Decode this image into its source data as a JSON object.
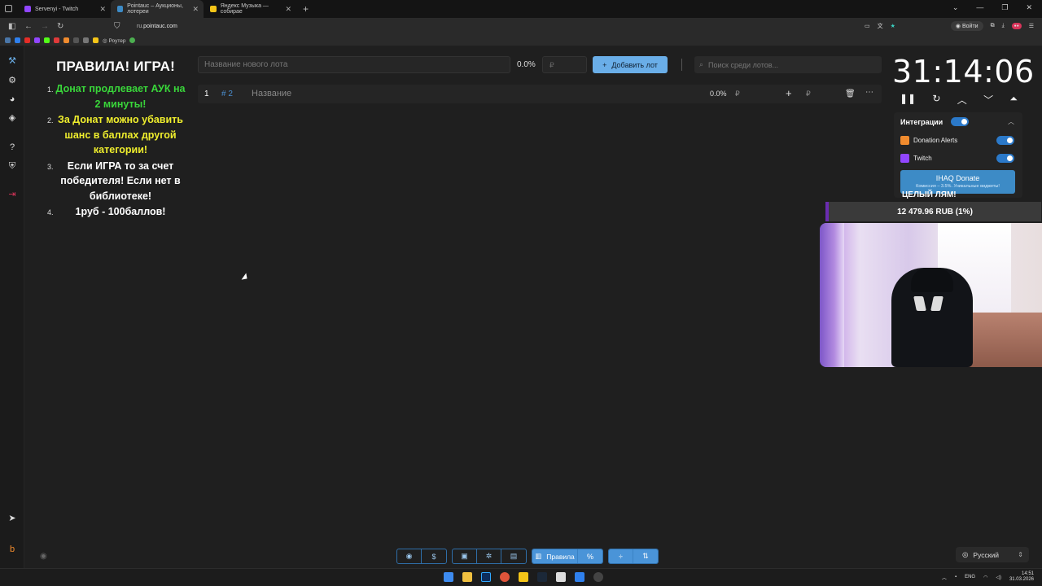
{
  "browser": {
    "tabs": [
      {
        "title": "Servenyi - Twitch",
        "favicon_color": "#9146ff",
        "active": false
      },
      {
        "title": "Pointauc – Аукционы, лотереи",
        "favicon_color": "#3d8bc6",
        "active": true
      },
      {
        "title": "Яндекс Музыка — собирае",
        "favicon_color": "#f5c518",
        "active": false
      }
    ],
    "url_prefix": "ru.",
    "url_domain": "pointauc.com",
    "login_label": "Войти",
    "bookmarks_label": "Роутер"
  },
  "rules": {
    "title": "ПРАВИЛА! ИГРА!",
    "items": [
      {
        "num": "1.",
        "parts": [
          {
            "text": "Донат продлевает АУК на 2 минуты!",
            "color": "green"
          }
        ]
      },
      {
        "num": "2.",
        "parts": [
          {
            "text": "За Донат можно убавить шанс в баллах другой категории!",
            "color": "yellow"
          }
        ]
      },
      {
        "num": "3.",
        "parts": [
          {
            "text": "Если ИГРА то за счет победителя! Если нет в библиотеке!",
            "color": "white"
          }
        ]
      },
      {
        "num": "4.",
        "parts": [
          {
            "text": "1руб - 100баллов!",
            "color": "white"
          }
        ]
      }
    ]
  },
  "lot_form": {
    "name_placeholder": "Название нового лота",
    "percent": "0.0%",
    "amount_placeholder": "₽",
    "add_label": "Добавить лот",
    "search_placeholder": "Поиск среди лотов..."
  },
  "lots": [
    {
      "index": "1",
      "id": "# 2",
      "name": "Название",
      "percent": "0.0%",
      "currency": "₽"
    }
  ],
  "timer": {
    "value": "31:14:06"
  },
  "integrations": {
    "header": "Интеграции",
    "items": [
      {
        "name": "Donation Alerts",
        "color": "#f08b2e"
      },
      {
        "name": "Twitch",
        "color": "#9146ff"
      }
    ],
    "ihaq_title": "IHAQ Donate",
    "ihaq_sub": "Комиссия – 3.5%. Уникальные виджеты!"
  },
  "goal": {
    "title": "ЦЕЛЫЙ ЛЯМ!",
    "progress_text": "12 479.96 RUB (1%)",
    "progress_fraction": 0.01
  },
  "bottom_toolbar": {
    "rules_label": "Правила"
  },
  "language": {
    "selected": "Русский"
  },
  "taskbar": {
    "lang": "ENG",
    "time": "14:51",
    "date": "31.03.2026"
  },
  "colors": {
    "accent": "#6aaee8",
    "rule_green": "#39d63a",
    "rule_yellow": "#f0ef2d",
    "goal_bar": "#6a2cb0"
  }
}
